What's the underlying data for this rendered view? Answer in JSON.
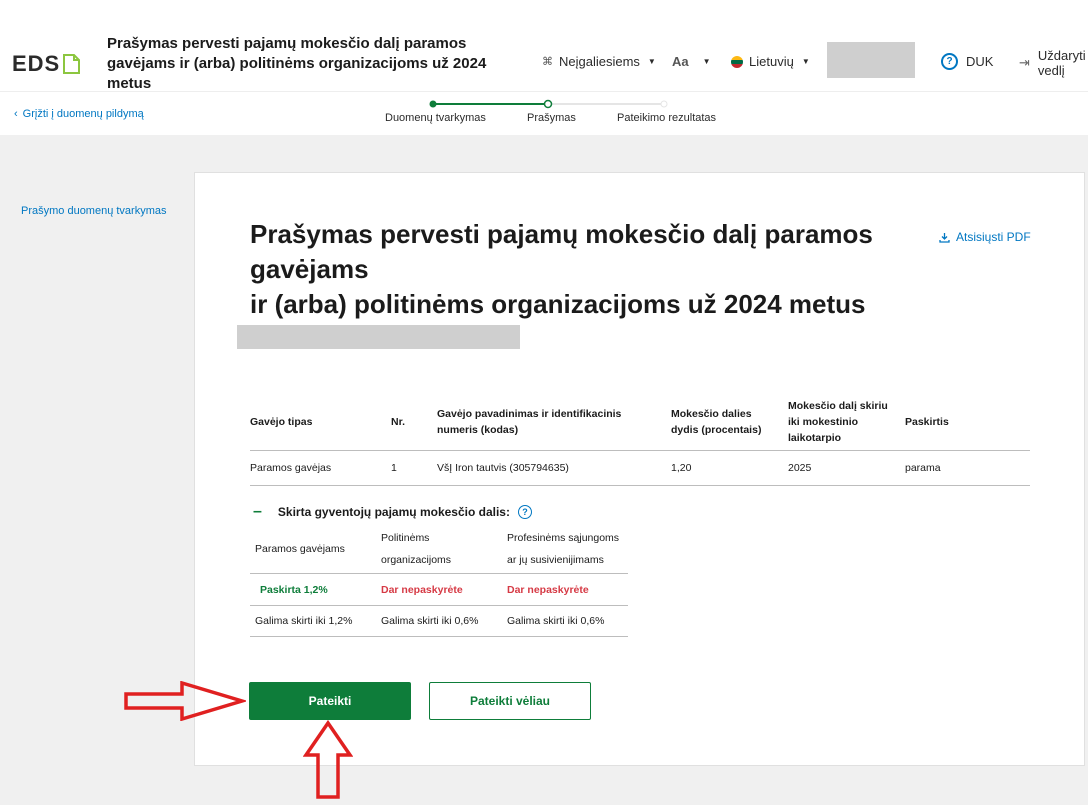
{
  "header": {
    "logo": "EDS",
    "title": "Prašymas pervesti pajamų mokesčio dalį paramos gavėjams ir (arba) politinėms organizacijoms už 2024 metus",
    "accessibility_label": "Neįgaliesiems",
    "font_size_label": "Aa",
    "language_label": "Lietuvių",
    "help_label": "DUK",
    "close_label_line1": "Uždaryti",
    "close_label_line2": "vedlį"
  },
  "subbar": {
    "back_label": "Grįžti į duomenų pildymą",
    "steps": [
      {
        "label": "Duomenų tvarkymas"
      },
      {
        "label": "Prašymas"
      },
      {
        "label": "Pateikimo rezultatas"
      }
    ]
  },
  "left_nav": {
    "item": "Prašymo duomenų tvarkymas"
  },
  "card": {
    "title_line1": "Prašymas pervesti pajamų mokesčio dalį paramos",
    "title_line2": "gavėjams",
    "title_line3": "ir (arba) politinėms organizacijoms už 2024 metus",
    "pdf_label": "Atsisiųsti PDF",
    "table": {
      "headers": [
        "Gavėjo tipas",
        "Nr.",
        "Gavėjo pavadinimas ir identifikacinis numeris (kodas)",
        "Mokesčio dalies dydis (procentais)",
        "Mokesčio dalį skiriu iki mokestinio laikotarpio",
        "Paskirtis"
      ],
      "rows": [
        [
          "Paramos gavėjas",
          "1",
          "VšĮ Iron tautvis (305794635)",
          "1,20",
          "2025",
          "parama"
        ]
      ]
    },
    "distribution": {
      "title": "Skirta gyventojų pajamų mokesčio dalis:",
      "columns": [
        "Paramos gavėjams",
        "Politinėms organizacijoms",
        "Profesinėms sąjungoms ar jų susivienijimams"
      ],
      "status": [
        "Paskirta 1,2%",
        "Dar nepaskyrėte",
        "Dar nepaskyrėte"
      ],
      "limits": [
        "Galima skirti iki 1,2%",
        "Galima skirti iki 0,6%",
        "Galima skirti iki 0,6%"
      ]
    },
    "submit_label": "Pateikti",
    "later_label": "Pateikti vėliau"
  },
  "colors": {
    "primary_green": "#0e7d3a",
    "link_blue": "#0077c2",
    "warning_red": "#d63a45",
    "annotation_red": "#e02020"
  }
}
